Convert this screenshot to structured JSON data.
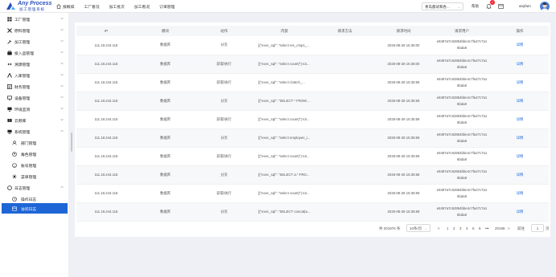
{
  "header": {
    "logo_name": "Any Process",
    "logo_sub": "加工管理系统",
    "nav": [
      "按概如",
      "工厂看况",
      "加工批次",
      "加工看况",
      "订单管理"
    ],
    "company": "青岛都试和各...",
    "helper_label": "帮助",
    "badge_count": "1",
    "username": "anyfam"
  },
  "sidebar": {
    "items": [
      {
        "label": "工厂管理",
        "icon": "factory-icon"
      },
      {
        "label": "原料管理",
        "icon": "tools-icon"
      },
      {
        "label": "加工管理",
        "icon": "wrench-icon"
      },
      {
        "label": "投入品管理",
        "icon": "inputs-icon"
      },
      {
        "label": "溯源管理",
        "icon": "trace-icon"
      },
      {
        "label": "入库管理",
        "icon": "warehouse-in-icon"
      },
      {
        "label": "财务管理",
        "icon": "finance-icon"
      },
      {
        "label": "设备管理",
        "icon": "device-icon"
      },
      {
        "label": "环境监测",
        "icon": "monitor-icon"
      },
      {
        "label": "云频库",
        "icon": "cloud-icon"
      },
      {
        "label": "系统管理",
        "icon": "system-icon"
      },
      {
        "label": "部门管理",
        "icon": "department-icon"
      },
      {
        "label": "角色管理",
        "icon": "role-icon"
      },
      {
        "label": "账号管理",
        "icon": "account-icon"
      },
      {
        "label": "菜单管理",
        "icon": "menu-icon"
      },
      {
        "label": "日志管理",
        "icon": "log-icon"
      },
      {
        "label": "操作日志",
        "icon": "clock-icon"
      },
      {
        "label": "访问日志",
        "icon": "access-log-icon"
      }
    ]
  },
  "table": {
    "headers": [
      "IP",
      "模块",
      "动作",
      "内容",
      "请求方法",
      "请求时间",
      "请求用户",
      "操作"
    ],
    "rows": [
      {
        "ip": "111.18.244.115",
        "module": "数据库",
        "action": "分页",
        "content": "[{\"exec_sql\": \"select res_cmps_...",
        "method": "",
        "time": "2025-08-28 15:36:00",
        "user": "e8497a7c62854bbe4c7fa47c7a1 6bda8",
        "op": "详情"
      },
      {
        "ip": "111.18.244.115",
        "module": "数据库",
        "action": "获取/执行",
        "content": "[{\"exec_sql\": \"select count(*) tot...",
        "method": "",
        "time": "2025-08-28 15:36:00",
        "user": "e8497a7c62854bbe4c7fa47c7a1 6bda8",
        "op": "详情"
      },
      {
        "ip": "111.18.244.115",
        "module": "数据库",
        "action": "获取/执行",
        "content": "[{\"exec_sql\": \"select t.batch_...",
        "method": "",
        "time": "2025-08-28 15:35:59",
        "user": "e8497a7c62854bbe4c7fa47c7a1 6bda8",
        "op": "详情"
      },
      {
        "ip": "111.18.244.115",
        "module": "数据库",
        "action": "分页",
        "content": "[{\"exec_sql\": \"SELECT * FROM ...",
        "method": "",
        "time": "2025-08-28 15:35:59",
        "user": "e8497a7c62854bbe4c7fa47c7a1 6bda8",
        "op": "详情"
      },
      {
        "ip": "111.18.244.115",
        "module": "数据库",
        "action": "获取/执行",
        "content": "[{\"exec_sql\": \"select count(*) tot...",
        "method": "",
        "time": "2025-08-28 15:35:59",
        "user": "e8497a7c62854bbe4c7fa47c7a1 6bda8",
        "op": "详情"
      },
      {
        "ip": "111.18.244.115",
        "module": "数据库",
        "action": "分页",
        "content": "[{\"exec_sql\": \"select employee_i...",
        "method": "",
        "time": "2025-08-28 15:35:59",
        "user": "e8497a7c62854bbe4c7fa47c7a1 6bda8",
        "op": "详情"
      },
      {
        "ip": "111.18.244.115",
        "module": "数据库",
        "action": "获取/执行",
        "content": "[{\"exec_sql\": \"select count(*) tot...",
        "method": "",
        "time": "2025-08-28 15:35:59",
        "user": "e8497a7c62854bbe4c7fa47c7a1 6bda8",
        "op": "详情"
      },
      {
        "ip": "111.18.244.115",
        "module": "数据库",
        "action": "分页",
        "content": "[{\"exec_sql\": \"SELECT a.* FRO...",
        "method": "",
        "time": "2025-08-28 15:35:58",
        "user": "e8497a7c62854bbe4c7fa47c7a1 6bda8",
        "op": "详情"
      },
      {
        "ip": "111.18.244.115",
        "module": "数据库",
        "action": "获取/执行",
        "content": "[{\"exec_sql\": \"select count(*) tot...",
        "method": "",
        "time": "2025-08-28 15:35:59",
        "user": "e8497a7c62854bbe4c7fa47c7a1 6bda8",
        "op": "详情"
      },
      {
        "ip": "111.18.244.115",
        "module": "数据库",
        "action": "分页",
        "content": "[{\"exec_sql\": \"SELECT concat(a...",
        "method": "",
        "time": "2025-08-28 15:35:59",
        "user": "e8497a7c62854bbe4c7fa47c7a1 6bda8",
        "op": "详情"
      }
    ]
  },
  "pager": {
    "total": "共 201976 条",
    "size": "10条/页",
    "pages": [
      "1",
      "2",
      "3",
      "4",
      "5",
      "6",
      "•••",
      "20198"
    ],
    "prev": "<",
    "next": ">",
    "goto_label": "前往",
    "goto_value": "1",
    "goto_suffix": "页"
  },
  "colors": {
    "accent": "#1e66d6",
    "badge": "#f5222d"
  }
}
